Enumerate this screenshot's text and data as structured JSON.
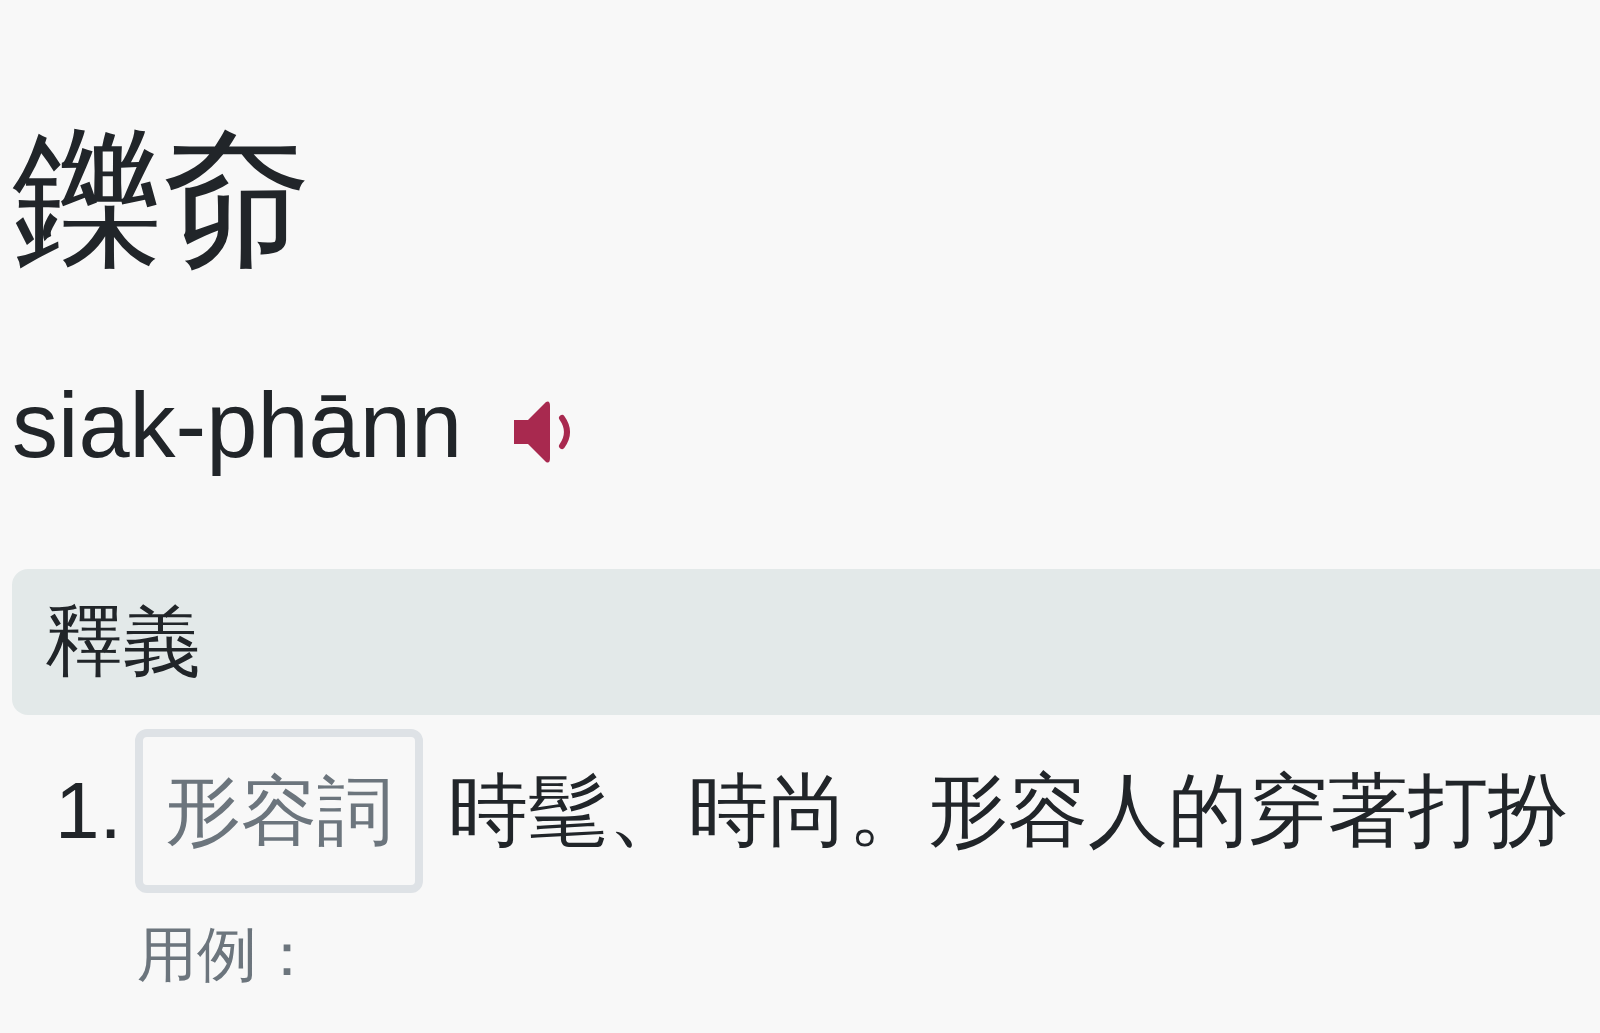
{
  "entry": {
    "headword": "鑠奅",
    "romanization": "siak-phānn"
  },
  "section": {
    "title": "釋義"
  },
  "definitions": [
    {
      "number": "1.",
      "part_of_speech": "形容詞",
      "text": "時髦、時尚。形容人的穿著打扮",
      "example_label": "用例："
    }
  ]
}
